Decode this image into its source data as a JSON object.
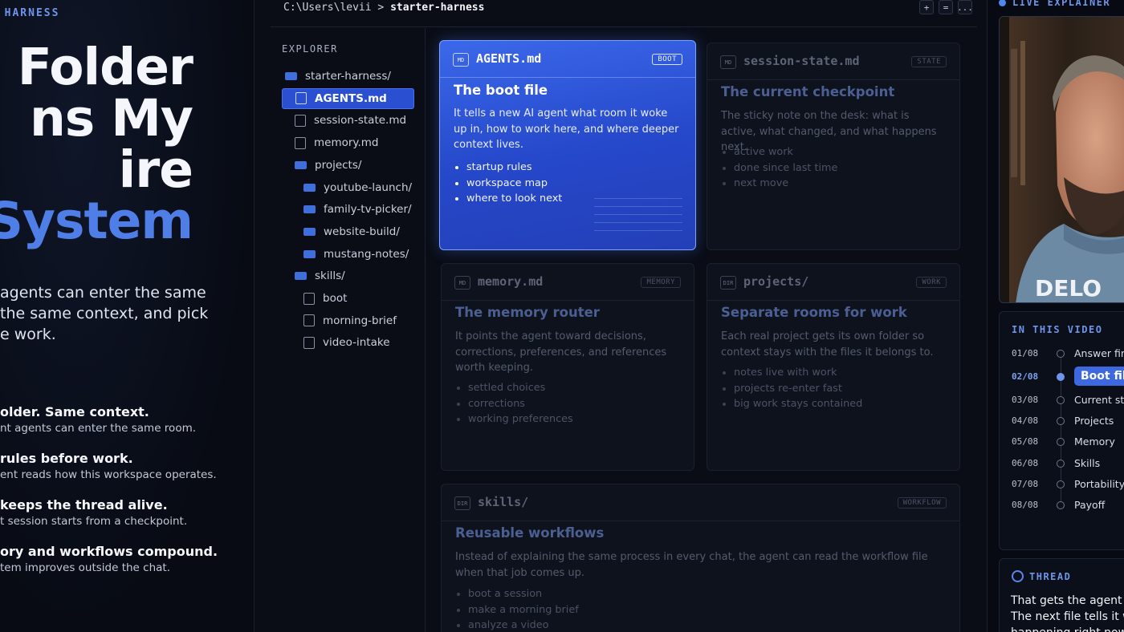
{
  "hero": {
    "kicker": "I HARNESS",
    "headline_lines": [
      "s Folder",
      "ns My",
      "ire",
      "System"
    ],
    "lede_lines": [
      "agents can enter the same",
      "the same context, and pick",
      "e work."
    ],
    "points": [
      {
        "title": "older. Same context.",
        "sub": "nt agents can enter the same room."
      },
      {
        "title": "rules before work.",
        "sub": "ent reads how this workspace operates."
      },
      {
        "title": "keeps the thread alive.",
        "sub": "t session starts from a checkpoint."
      },
      {
        "title": "ory and workflows compound.",
        "sub": "tem improves outside the chat."
      }
    ]
  },
  "terminal": {
    "path_prefix": "C:\\Users\\levii > ",
    "path_current": "starter-harness",
    "controls": [
      "+",
      "=",
      "..."
    ]
  },
  "explorer": {
    "title": "EXPLORER",
    "items": [
      {
        "label": "starter-harness/",
        "type": "folder",
        "depth": 0
      },
      {
        "label": "AGENTS.md",
        "type": "file",
        "depth": 1,
        "active": true
      },
      {
        "label": "session-state.md",
        "type": "file",
        "depth": 1
      },
      {
        "label": "memory.md",
        "type": "file",
        "depth": 1
      },
      {
        "label": "projects/",
        "type": "folder",
        "depth": 1
      },
      {
        "label": "youtube-launch/",
        "type": "folder",
        "depth": 2
      },
      {
        "label": "family-tv-picker/",
        "type": "folder",
        "depth": 2
      },
      {
        "label": "website-build/",
        "type": "folder",
        "depth": 2
      },
      {
        "label": "mustang-notes/",
        "type": "folder",
        "depth": 2
      },
      {
        "label": "skills/",
        "type": "folder",
        "depth": 1
      },
      {
        "label": "boot",
        "type": "file",
        "depth": 2
      },
      {
        "label": "morning-brief",
        "type": "file",
        "depth": 2
      },
      {
        "label": "video-intake",
        "type": "file",
        "depth": 2
      }
    ]
  },
  "cards": [
    {
      "type": "MD",
      "file": "AGENTS.md",
      "tag": "BOOT",
      "title": "The boot file",
      "desc": "It tells a new AI agent what room it woke up in, how to work here, and where deeper context lives.",
      "bullets": [
        "startup rules",
        "workspace map",
        "where to look next"
      ],
      "active": true
    },
    {
      "type": "MD",
      "file": "session-state.md",
      "tag": "STATE",
      "title": "The current checkpoint",
      "desc": "The sticky note on the desk: what is active, what changed, and what happens next.",
      "bullets": [
        "active work",
        "done since last time",
        "next move"
      ]
    },
    {
      "type": "MD",
      "file": "memory.md",
      "tag": "MEMORY",
      "title": "The memory router",
      "desc": "It points the agent toward decisions, corrections, preferences, and references worth keeping.",
      "bullets": [
        "settled choices",
        "corrections",
        "working preferences"
      ]
    },
    {
      "type": "DIR",
      "file": "projects/",
      "tag": "WORK",
      "title": "Separate rooms for work",
      "desc": "Each real project gets its own folder so context stays with the files it belongs to.",
      "bullets": [
        "notes live with work",
        "projects re-enter fast",
        "big work stays contained"
      ]
    },
    {
      "type": "DIR",
      "file": "skills/",
      "tag": "WORKFLOW",
      "title": "Reusable workflows",
      "desc": "Instead of explaining the same process in every chat, the agent can read the workflow file when that job comes up.",
      "bullets": [
        "boot a session",
        "make a morning brief",
        "analyze a video"
      ]
    }
  ],
  "live": {
    "label": "LIVE EXPLAINER",
    "shirt_text": "DELO"
  },
  "video": {
    "title": "IN THIS VIDEO",
    "chapters": [
      {
        "num": "01/08",
        "label": "Answer firs"
      },
      {
        "num": "02/08",
        "label": "Boot fil",
        "active": true
      },
      {
        "num": "03/08",
        "label": "Current sta"
      },
      {
        "num": "04/08",
        "label": "Projects"
      },
      {
        "num": "05/08",
        "label": "Memory"
      },
      {
        "num": "06/08",
        "label": "Skills"
      },
      {
        "num": "07/08",
        "label": "Portability"
      },
      {
        "num": "08/08",
        "label": "Payoff"
      }
    ]
  },
  "thread": {
    "title": "THREAD",
    "lines": [
      "That gets the agent",
      "The next file tells it w",
      "happening right now"
    ]
  },
  "colors": {
    "accent": "#4f7fe6",
    "active_card": "#2a4fd1",
    "background": "#070a12"
  }
}
